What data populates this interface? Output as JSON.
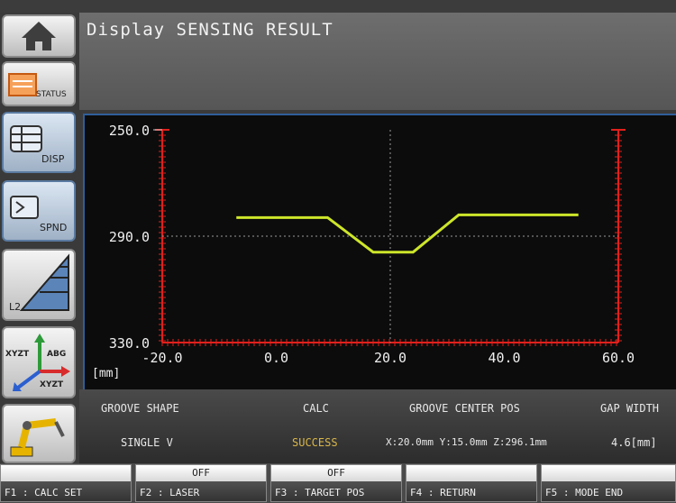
{
  "title": "Display SENSING RESULT",
  "sidebar": {
    "items": [
      {
        "name": "home",
        "label": ""
      },
      {
        "name": "status",
        "label": "STATUS"
      },
      {
        "name": "disp",
        "label": "DISP"
      },
      {
        "name": "spnd",
        "label": "SPND"
      },
      {
        "name": "l2",
        "label": "L2"
      },
      {
        "name": "abg",
        "label_top": "ABG",
        "label_left": "XYZT",
        "label_bottom": "XYZT"
      },
      {
        "name": "robot",
        "label": ""
      }
    ]
  },
  "chart_data": {
    "type": "line",
    "xlabel": "[mm]",
    "x_ticks": [
      "-20.0",
      "0.0",
      "20.0",
      "40.0",
      "60.0"
    ],
    "y_ticks": [
      "250.0",
      "290.0",
      "330.0"
    ],
    "xlim": [
      -20,
      60
    ],
    "ylim": [
      330,
      250
    ],
    "series": [
      {
        "x": [
          -7,
          9,
          17,
          24,
          32,
          53
        ],
        "y": [
          283,
          283,
          296,
          296,
          282,
          282
        ],
        "color": "#cde62a"
      }
    ]
  },
  "info": {
    "groove_shape_label": "GROOVE SHAPE",
    "groove_shape_value": "SINGLE V",
    "calc_label": "CALC",
    "calc_value": "SUCCESS",
    "center_label": "GROOVE CENTER POS",
    "center_value": "X:20.0mm Y:15.0mm Z:296.1mm",
    "gap_label": "GAP WIDTH",
    "gap_value": "4.6[mm]"
  },
  "fkeys": [
    {
      "top": "",
      "label": "F1 : CALC SET"
    },
    {
      "top": "OFF",
      "label": "F2 : LASER"
    },
    {
      "top": "OFF",
      "label": "F3 : TARGET POS"
    },
    {
      "top": "",
      "label": "F4 : RETURN"
    },
    {
      "top": "",
      "label": "F5 : MODE END"
    }
  ],
  "colors": {
    "grid_red": "#e0201c",
    "curve": "#cde62a",
    "success": "#d9b64a",
    "accent_blue": "#2f5f9a"
  }
}
